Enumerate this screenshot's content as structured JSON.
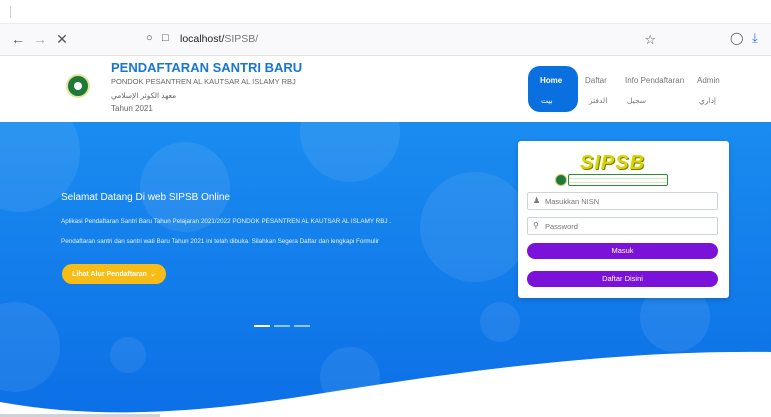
{
  "browser": {
    "url_host": "localhost/",
    "url_path": "SIPSB/",
    "icons": [
      "back-arrow-icon",
      "forward-arrow-icon",
      "close-icon",
      "shield-icon",
      "page-icon",
      "star-icon",
      "pocket-icon",
      "download-icon"
    ]
  },
  "site": {
    "title": "PENDAFTARAN SANTRI BARU",
    "subtitle": "PONDOK PESANTREN AL KAUTSAR AL ISLAMY RBJ",
    "arabic": "معهد الكوثر الإسلامي",
    "year": "Tahun 2021"
  },
  "menu": {
    "items": [
      {
        "label": "Home",
        "arabic": "بيت"
      },
      {
        "label": "Daftar",
        "arabic": "الدفتر"
      },
      {
        "label": "Info Pendaftaran",
        "arabic": "سجيل"
      },
      {
        "label": "Admin",
        "arabic": "إداري"
      }
    ],
    "active_color": "#0a6fdf"
  },
  "hero": {
    "heading": "Selamat Datang Di web SIPSB Online",
    "paragraph1": "Aplikasi Pendaftaran Santri Baru Tahun Pelajaran 2021/2022 PONDOK PESANTREN AL KAUTSAR AL ISLAMY RBJ .",
    "paragraph2": "Pendaftaran santri dan santri wati Baru Tahun 2021 ini telah dibuka. Silahkan Segera Daftar dan lengkapi Formulir",
    "button_label": "Lihat Alur Pendaftaran",
    "button_color": "#f7bd16",
    "background_color": "#1a8cf0"
  },
  "login": {
    "logo_text": "SIPSB",
    "nisn_placeholder": "Masukkan NISN",
    "password_placeholder": "Password",
    "masuk_label": "Masuk",
    "daftar_label": "Daftar Disini",
    "button_color": "#7b12d9"
  }
}
